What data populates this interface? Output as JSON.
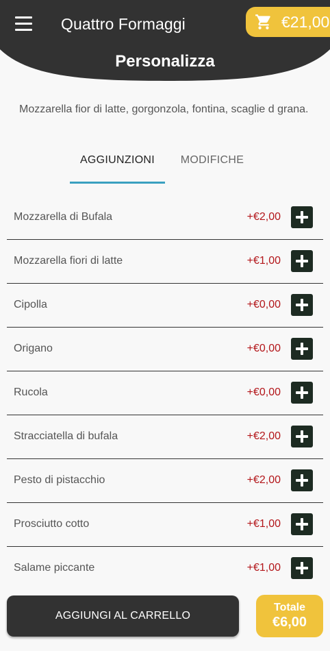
{
  "header": {
    "app_title": "Quattro Formaggi",
    "cart_amount": "€21,00",
    "page_title": "Personalizza"
  },
  "description": "Mozzarella fior di latte, gorgonzola, fontina, scaglie d grana.",
  "tabs": [
    {
      "label": "AGGIUNZIONI",
      "active": true
    },
    {
      "label": "MODIFICHE",
      "active": false
    }
  ],
  "items": [
    {
      "name": "Mozzarella di Bufala",
      "price": "+€2,00"
    },
    {
      "name": "Mozzarella fiori di latte",
      "price": "+€1,00"
    },
    {
      "name": "Cipolla",
      "price": "+€0,00"
    },
    {
      "name": "Origano",
      "price": "+€0,00"
    },
    {
      "name": "Rucola",
      "price": "+€0,00"
    },
    {
      "name": "Stracciatella di bufala",
      "price": "+€2,00"
    },
    {
      "name": "Pesto di pistacchio",
      "price": "+€2,00"
    },
    {
      "name": "Prosciutto cotto",
      "price": "+€1,00"
    },
    {
      "name": "Salame piccante",
      "price": "+€1,00"
    }
  ],
  "footer": {
    "add_to_cart_label": "AGGIUNGI AL CARRELLO",
    "total_label": "Totale",
    "total_value": "€6,00"
  },
  "colors": {
    "header": "#323232",
    "accent": "#f0c33c",
    "price": "#b3161a",
    "tab_indicator": "#3aa0c0",
    "add_button": "#1d2b22"
  },
  "icons": {
    "menu": "menu-icon",
    "cart": "cart-icon",
    "add": "plus-icon"
  }
}
